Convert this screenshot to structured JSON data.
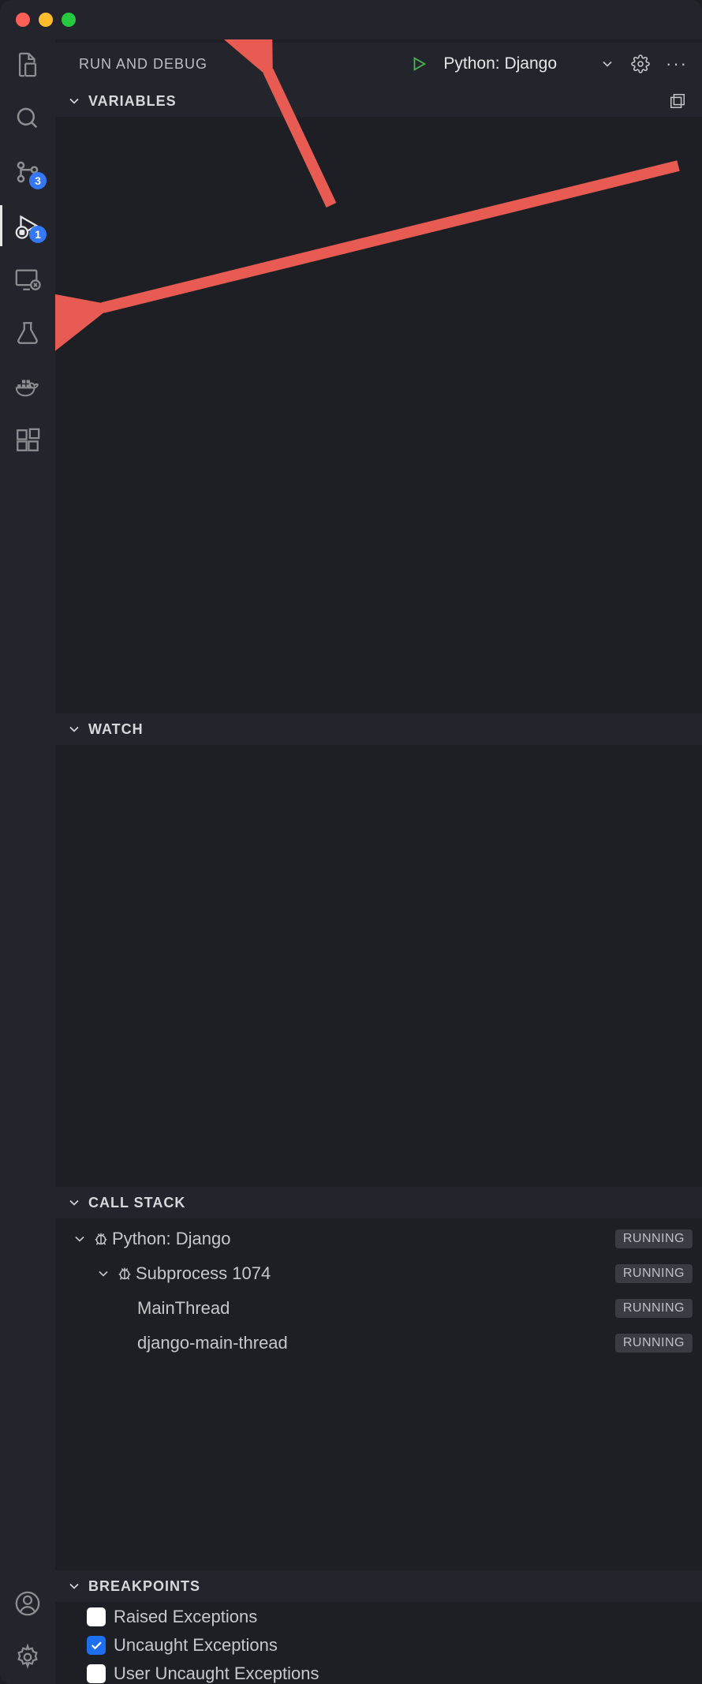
{
  "header": {
    "title": "RUN AND DEBUG",
    "config_name": "Python: Django"
  },
  "activitybar": {
    "source_control_badge": "3",
    "run_debug_badge": "1"
  },
  "sections": {
    "variables": {
      "title": "VARIABLES"
    },
    "watch": {
      "title": "WATCH"
    },
    "callstack": {
      "title": "CALL STACK",
      "items": [
        {
          "label": "Python: Django",
          "status": "RUNNING",
          "indent": 0,
          "expandable": true,
          "icon": "bug"
        },
        {
          "label": "Subprocess 1074",
          "status": "RUNNING",
          "indent": 1,
          "expandable": true,
          "icon": "bug"
        },
        {
          "label": "MainThread",
          "status": "RUNNING",
          "indent": 2,
          "expandable": false,
          "icon": ""
        },
        {
          "label": "django-main-thread",
          "status": "RUNNING",
          "indent": 2,
          "expandable": false,
          "icon": ""
        }
      ]
    },
    "breakpoints": {
      "title": "BREAKPOINTS",
      "items": [
        {
          "label": "Raised Exceptions",
          "checked": false
        },
        {
          "label": "Uncaught Exceptions",
          "checked": true
        },
        {
          "label": "User Uncaught Exceptions",
          "checked": false
        }
      ]
    }
  }
}
